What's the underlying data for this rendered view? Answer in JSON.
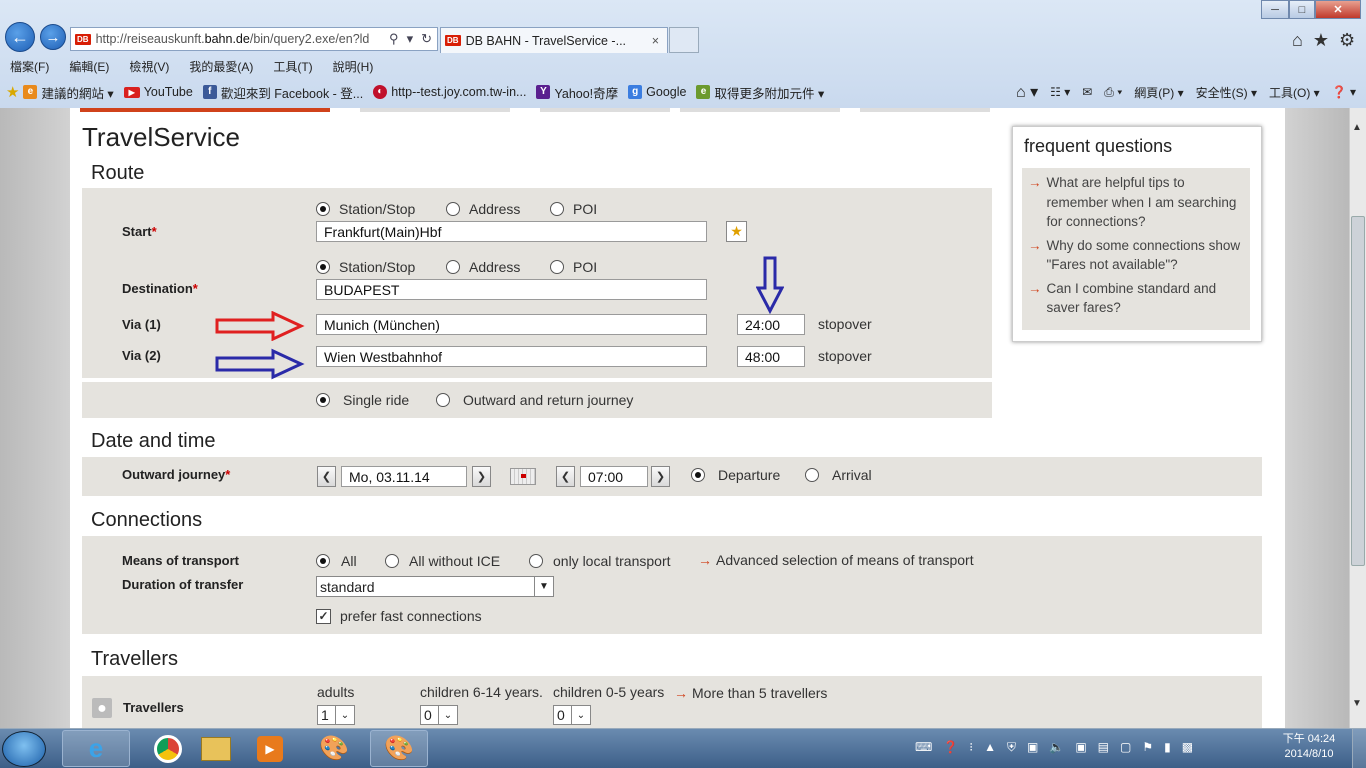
{
  "browser": {
    "address": "http://reiseauskunft.bahn.de/bin/query2.exe/en?ld",
    "address_prefix": "http://reiseauskunft.",
    "address_domain": "bahn.de",
    "address_path": "/bin/query2.exe/en?ld",
    "tab_title": "DB BAHN - TravelService -...",
    "menu": [
      "檔案(F)",
      "編輯(E)",
      "檢視(V)",
      "我的最愛(A)",
      "工具(T)",
      "說明(H)"
    ],
    "favorites": [
      "建議的網站 ▾",
      "YouTube",
      "歡迎來到 Facebook - 登...",
      "http--test.joy.com.tw-in...",
      "Yahoo!奇摩",
      "Google",
      "取得更多附加元件 ▾"
    ],
    "commands": [
      "網頁(P) ▾",
      "安全性(S) ▾",
      "工具(O) ▾"
    ]
  },
  "page": {
    "title": "TravelService",
    "route": {
      "heading": "Route",
      "start_label": "Start",
      "destination_label": "Destination",
      "req": "*",
      "options": [
        "Station/Stop",
        "Address",
        "POI"
      ],
      "start_value": "Frankfurt(Main)Hbf",
      "destination_value": "BUDAPEST",
      "via1_label": "Via (1)",
      "via1_value": "Munich (München)",
      "via1_time": "24:00",
      "via2_label": "Via (2)",
      "via2_value": "Wien Westbahnhof",
      "via2_time": "48:00",
      "stopover": "stopover",
      "single": "Single ride",
      "return": "Outward and return journey"
    },
    "datetime": {
      "heading": "Date and time",
      "label": "Outward journey",
      "date": "Mo, 03.11.14",
      "time": "07:00",
      "departure": "Departure",
      "arrival": "Arrival"
    },
    "connections": {
      "heading": "Connections",
      "means_label": "Means of transport",
      "opt_all": "All",
      "opt_noice": "All without ICE",
      "opt_local": "only local transport",
      "advanced": "Advanced selection of means of transport",
      "duration_label": "Duration of transfer",
      "duration_value": "standard",
      "prefer_fast": "prefer fast connections"
    },
    "travellers": {
      "heading": "Travellers",
      "label": "Travellers",
      "adults_label": "adults",
      "adults_value": "1",
      "children614_label": "children 6-14 years.",
      "children614_value": "0",
      "children05_label": "children 0-5 years",
      "children05_value": "0",
      "more": "More than 5 travellers"
    },
    "faq": {
      "heading": "frequent questions",
      "items": [
        "What are helpful tips to remember when I am searching for connections?",
        "Why do some connections show \"Fares not available\"?",
        "Can I combine standard and saver fares?"
      ]
    }
  },
  "taskbar": {
    "time": "下午 04:24",
    "date": "2014/8/10"
  },
  "colors": {
    "accent": "#d0421b",
    "panel": "#e5e3de",
    "annotation_red": "#e02020",
    "annotation_blue": "#2a2aa8"
  }
}
